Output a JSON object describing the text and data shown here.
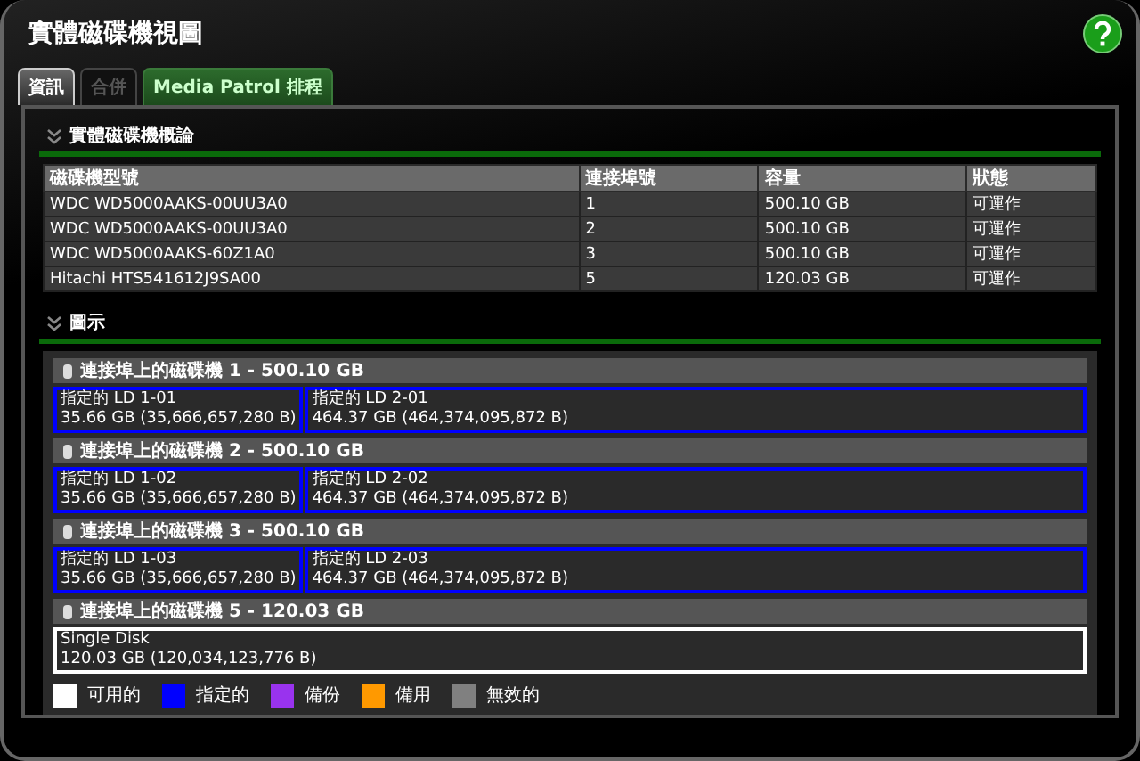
{
  "window": {
    "title": "實體磁碟機視圖"
  },
  "tabs": [
    {
      "label": "資訊",
      "selected": true,
      "disabled": false
    },
    {
      "label": "合併",
      "selected": false,
      "disabled": true
    },
    {
      "label": "Media Patrol 排程",
      "selected": false,
      "disabled": false
    }
  ],
  "overview": {
    "heading": "實體磁碟機概論",
    "expanded": true,
    "table": {
      "columns": [
        "磁碟機型號",
        "連接埠號",
        "容量",
        "狀態"
      ],
      "rows": [
        [
          "WDC WD5000AAKS-00UU3A0",
          "1",
          "500.10 GB",
          "可運作"
        ],
        [
          "WDC WD5000AAKS-00UU3A0",
          "2",
          "500.10 GB",
          "可運作"
        ],
        [
          "WDC WD5000AAKS-60Z1A0",
          "3",
          "500.10 GB",
          "可運作"
        ],
        [
          "Hitachi HTS541612J9SA00",
          "5",
          "120.03 GB",
          "可運作"
        ]
      ]
    }
  },
  "diagram": {
    "heading": "圖示",
    "expanded": true,
    "disks": [
      {
        "title": "連接埠上的磁碟機 1 - 500.10 GB",
        "partitions": [
          {
            "name": "指定的 LD 1-01",
            "size": "35.66 GB (35,666,657,280 B)",
            "color": "#0000ff"
          },
          {
            "name": "指定的 LD 2-01",
            "size": "464.37 GB (464,374,095,872 B)",
            "color": "#0000ff"
          }
        ]
      },
      {
        "title": "連接埠上的磁碟機 2 - 500.10 GB",
        "partitions": [
          {
            "name": "指定的 LD 1-02",
            "size": "35.66 GB (35,666,657,280 B)",
            "color": "#0000ff"
          },
          {
            "name": "指定的 LD 2-02",
            "size": "464.37 GB (464,374,095,872 B)",
            "color": "#0000ff"
          }
        ]
      },
      {
        "title": "連接埠上的磁碟機 3 - 500.10 GB",
        "partitions": [
          {
            "name": "指定的 LD 1-03",
            "size": "35.66 GB (35,666,657,280 B)",
            "color": "#0000ff"
          },
          {
            "name": "指定的 LD 2-03",
            "size": "464.37 GB (464,374,095,872 B)",
            "color": "#0000ff"
          }
        ]
      },
      {
        "title": "連接埠上的磁碟機 5 - 120.03 GB",
        "partitions": [
          {
            "name": "Single Disk",
            "size": "120.03 GB (120,034,123,776 B)",
            "color": "#ffffff"
          }
        ]
      }
    ],
    "legend": [
      {
        "label": "可用的",
        "color": "#ffffff"
      },
      {
        "label": "指定的",
        "color": "#0000ff"
      },
      {
        "label": "備份",
        "color": "#9933ee"
      },
      {
        "label": "備用",
        "color": "#ff9900"
      },
      {
        "label": "無效的",
        "color": "#808080"
      }
    ]
  }
}
